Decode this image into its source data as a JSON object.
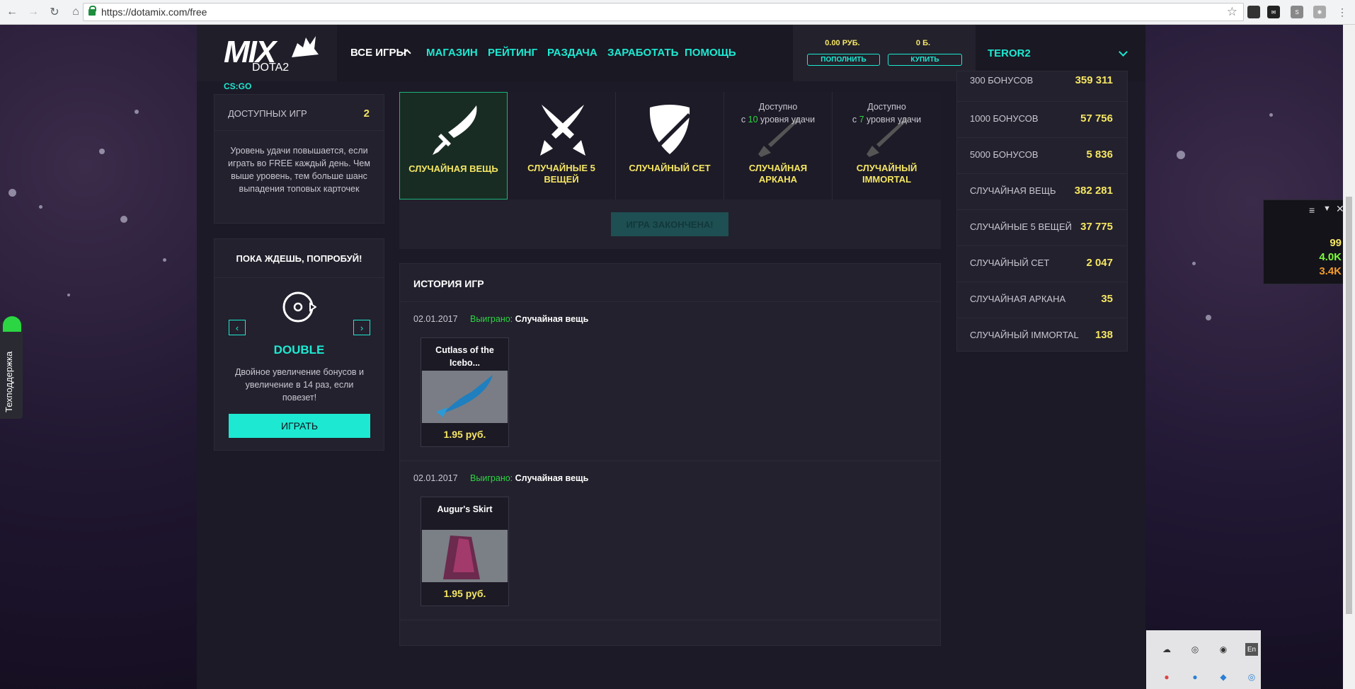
{
  "browser": {
    "url": "https://dotamix.com/free"
  },
  "header": {
    "logo_text": "MIX",
    "logo_sub": "DOTA2",
    "nav": [
      "ВСЕ ИГРЫ",
      "МАГАЗИН",
      "РЕЙТИНГ",
      "РАЗДАЧА",
      "ЗАРАБОТАТЬ",
      "ПОМОЩЬ"
    ],
    "balance_rub": "0.00 РУБ.",
    "balance_b": "0 Б.",
    "topup_label": "ПОПОЛНИТЬ",
    "buy_label": "КУПИТЬ",
    "username": "TEROR2",
    "game_switch": "CS:GO"
  },
  "left": {
    "games_label": "ДОСТУПНЫХ ИГР",
    "games_count": "2",
    "luck_text": "Уровень удачи повышается, если играть во FREE каждый день. Чем выше уровень, тем больше шанс выпадения топовых карточек",
    "try_title": "ПОКА ЖДЕШЬ, ПОПРОБУЙ!",
    "game_name": "DOUBLE",
    "game_desc": "Двойное увеличение бонусов и увеличение в 14 раз, если повезет!",
    "play_label": "ИГРАТЬ"
  },
  "cards": [
    {
      "title_1": "СЛУЧАЙНАЯ ВЕЩЬ",
      "title_2": "",
      "note_1": "",
      "note_2": "",
      "active": true
    },
    {
      "title_1": "СЛУЧАЙНЫЕ 5",
      "title_2": "ВЕЩЕЙ",
      "note_1": "",
      "note_2": "",
      "active": false
    },
    {
      "title_1": "СЛУЧАЙНЫЙ СЕТ",
      "title_2": "",
      "note_1": "",
      "note_2": "",
      "active": false
    },
    {
      "title_1": "СЛУЧАЙНАЯ",
      "title_2": "АРКАНА",
      "note_1": "Доступно",
      "note_2": "с 10 уровня удачи",
      "active": false
    },
    {
      "title_1": "СЛУЧАЙНЫЙ",
      "title_2": "IMMORTAL",
      "note_1": "Доступно",
      "note_2": "с 7 уровня удачи",
      "active": false
    }
  ],
  "game_over_label": "ИГРА ЗАКОНЧЕНА!",
  "history": {
    "title": "ИСТОРИЯ ИГР",
    "entries": [
      {
        "date": "02.01.2017",
        "won_label": "Выиграно:",
        "prize": "Случайная вещь",
        "item_name_1": "Cutlass of the",
        "item_name_2": "Icebo...",
        "price": "1.95 руб."
      },
      {
        "date": "02.01.2017",
        "won_label": "Выиграно:",
        "prize": "Случайная вещь",
        "item_name_1": "Augur's Skirt",
        "item_name_2": "",
        "price": "1.95 руб."
      }
    ]
  },
  "stats": [
    {
      "label": "300 БОНУСОВ",
      "value": "359 311"
    },
    {
      "label": "1000 БОНУСОВ",
      "value": "57 756"
    },
    {
      "label": "5000 БОНУСОВ",
      "value": "5 836"
    },
    {
      "label": "СЛУЧАЙНАЯ ВЕЩЬ",
      "value": "382 281"
    },
    {
      "label": "СЛУЧАЙНЫЕ 5 ВЕЩЕЙ",
      "value": "37 775"
    },
    {
      "label": "СЛУЧАЙНЫЙ СЕТ",
      "value": "2 047"
    },
    {
      "label": "СЛУЧАЙНАЯ АРКАНА",
      "value": "35"
    },
    {
      "label": "СЛУЧАЙНЫЙ IMMORTAL",
      "value": "138"
    }
  ],
  "support_label": "Техподдержка",
  "monitor": {
    "v1": "99",
    "v2": "4.0K",
    "v3": "3.4K"
  },
  "tray": {
    "lang": "En"
  },
  "colors": {
    "accent": "#1de9d2",
    "gold": "#f5e663",
    "win": "#2bd642"
  }
}
